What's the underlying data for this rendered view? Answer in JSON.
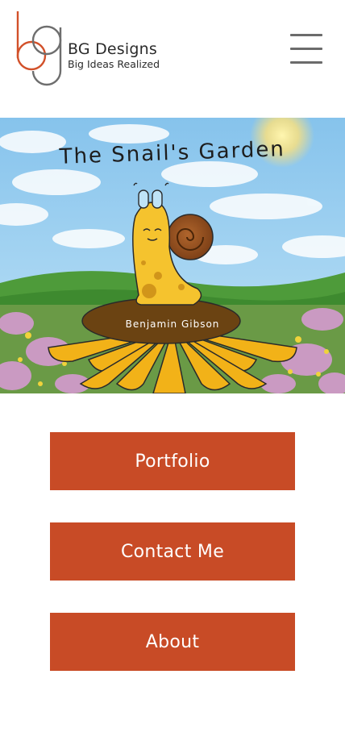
{
  "header": {
    "brand_name": "BG Designs",
    "brand_tagline": "Big Ideas Realized",
    "logo_icon": "bg-monogram-logo",
    "menu_icon": "hamburger-menu-icon"
  },
  "hero": {
    "book_title": "The Snail's Garden",
    "author": "Benjamin Gibson"
  },
  "nav": {
    "portfolio_label": "Portfolio",
    "contact_label": "Contact Me",
    "about_label": "About"
  },
  "colors": {
    "accent": "#c84b26",
    "logo_orange": "#d2512a",
    "logo_gray": "#6e6e6e",
    "text_dark": "#2b2b2b"
  }
}
